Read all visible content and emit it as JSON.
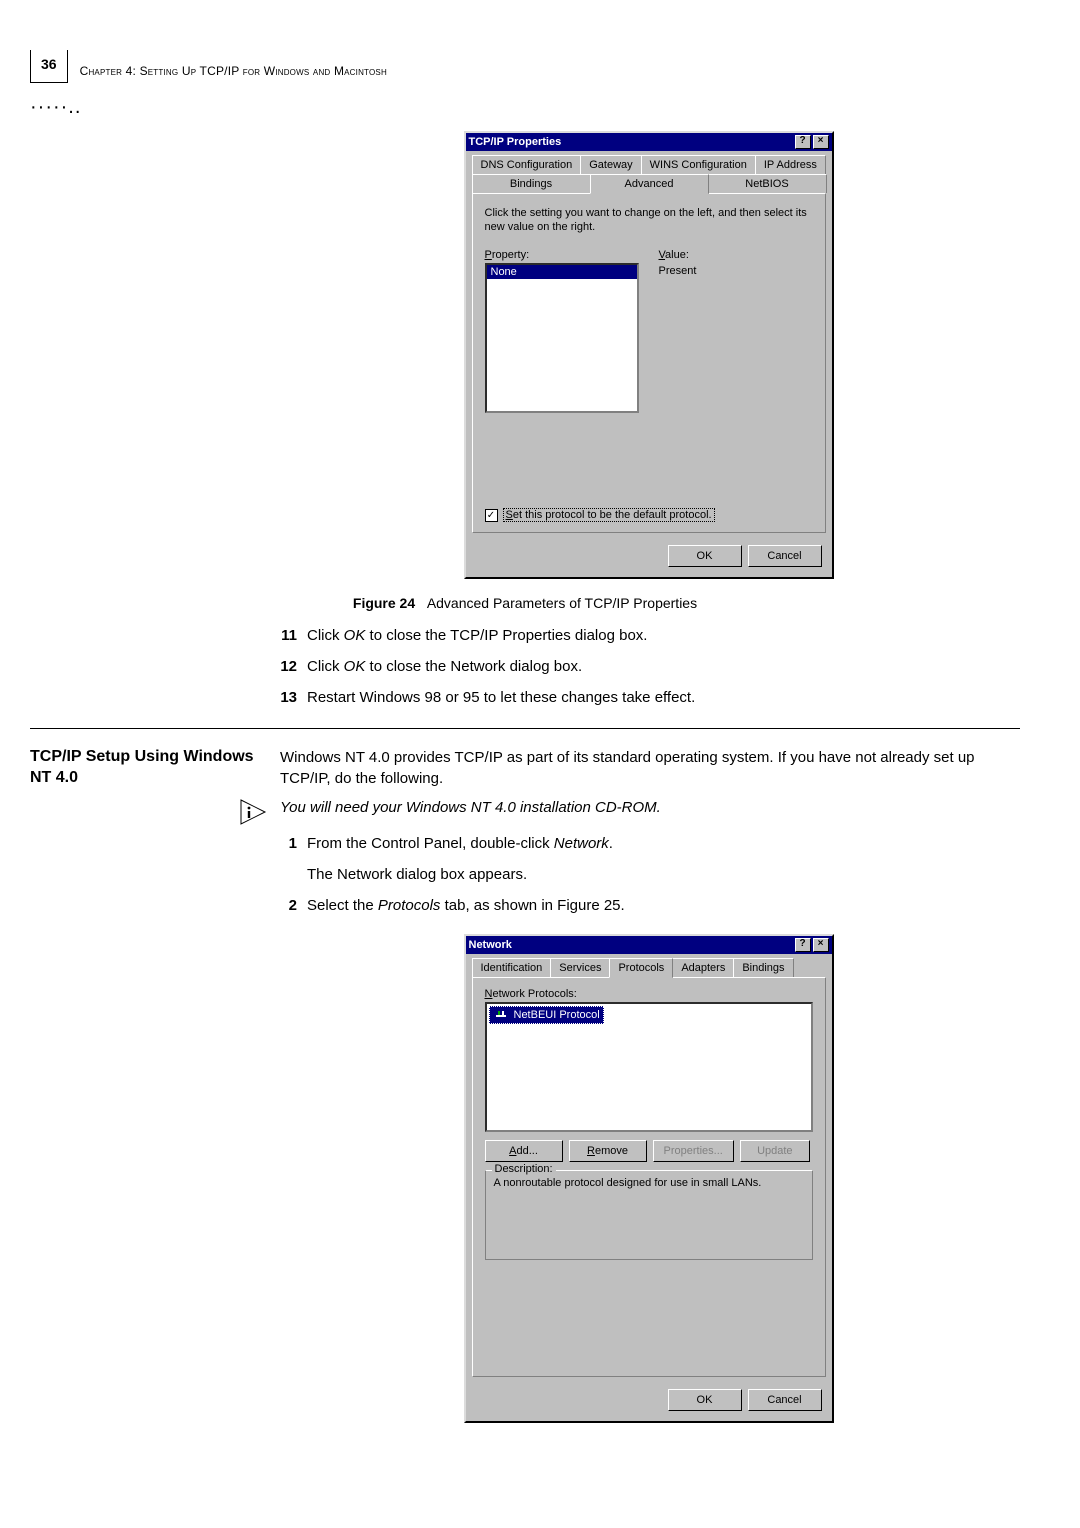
{
  "page": {
    "number": "36",
    "chapter_title": "Chapter 4: Setting Up TCP/IP for Windows and Macintosh"
  },
  "tcpip_dialog": {
    "title": "TCP/IP Properties",
    "help_btn": "?",
    "close_btn": "×",
    "tabs_row1": [
      "DNS Configuration",
      "Gateway",
      "WINS Configuration",
      "IP Address"
    ],
    "tabs_row2": [
      "Bindings",
      "Advanced",
      "NetBIOS"
    ],
    "active_tab": "Advanced",
    "help_text": "Click the setting you want to change on the left, and then select its new value on the right.",
    "property_label": "Property:",
    "property_underline": "P",
    "value_label": "Value:",
    "value_underline": "V",
    "property_selected": "None",
    "value_shown": "Present",
    "checkbox_checked": "✓",
    "checkbox_label": "Set this protocol to be the default protocol.",
    "ok": "OK",
    "cancel": "Cancel"
  },
  "figure24": {
    "label": "Figure 24",
    "caption": "Advanced Parameters of TCP/IP Properties"
  },
  "steps_a": [
    {
      "num": "11",
      "pre": "Click ",
      "em": "OK",
      "post": " to close the TCP/IP Properties dialog box."
    },
    {
      "num": "12",
      "pre": "Click ",
      "em": "OK",
      "post": " to close the Network dialog box."
    },
    {
      "num": "13",
      "pre": "Restart Windows 98 or 95 to let these changes take effect.",
      "em": "",
      "post": ""
    }
  ],
  "section": {
    "heading": "TCP/IP Setup Using Windows NT 4.0",
    "body": "Windows NT 4.0 provides TCP/IP as part of its standard operating system. If you have not already set up TCP/IP, do the following."
  },
  "note": "You will need your Windows NT 4.0 installation CD-ROM.",
  "steps_b": [
    {
      "num": "1",
      "pre": "From the Control Panel, double-click ",
      "em": "Network",
      "post": "."
    },
    {
      "num": "",
      "pre": "The Network dialog box appears.",
      "em": "",
      "post": ""
    },
    {
      "num": "2",
      "pre": "Select the ",
      "em": "Protocols",
      "post": " tab, as shown in Figure 25."
    }
  ],
  "network_dialog": {
    "title": "Network",
    "help_btn": "?",
    "close_btn": "×",
    "tabs": [
      "Identification",
      "Services",
      "Protocols",
      "Adapters",
      "Bindings"
    ],
    "active_tab": "Protocols",
    "list_label": "Network Protocols:",
    "list_underline": "N",
    "list_item": "NetBEUI Protocol",
    "buttons": {
      "add": "Add...",
      "remove": "Remove",
      "properties": "Properties...",
      "update": "Update"
    },
    "desc_legend": "Description:",
    "desc_text": "A nonroutable protocol designed for use in small LANs.",
    "ok": "OK",
    "cancel": "Cancel"
  }
}
